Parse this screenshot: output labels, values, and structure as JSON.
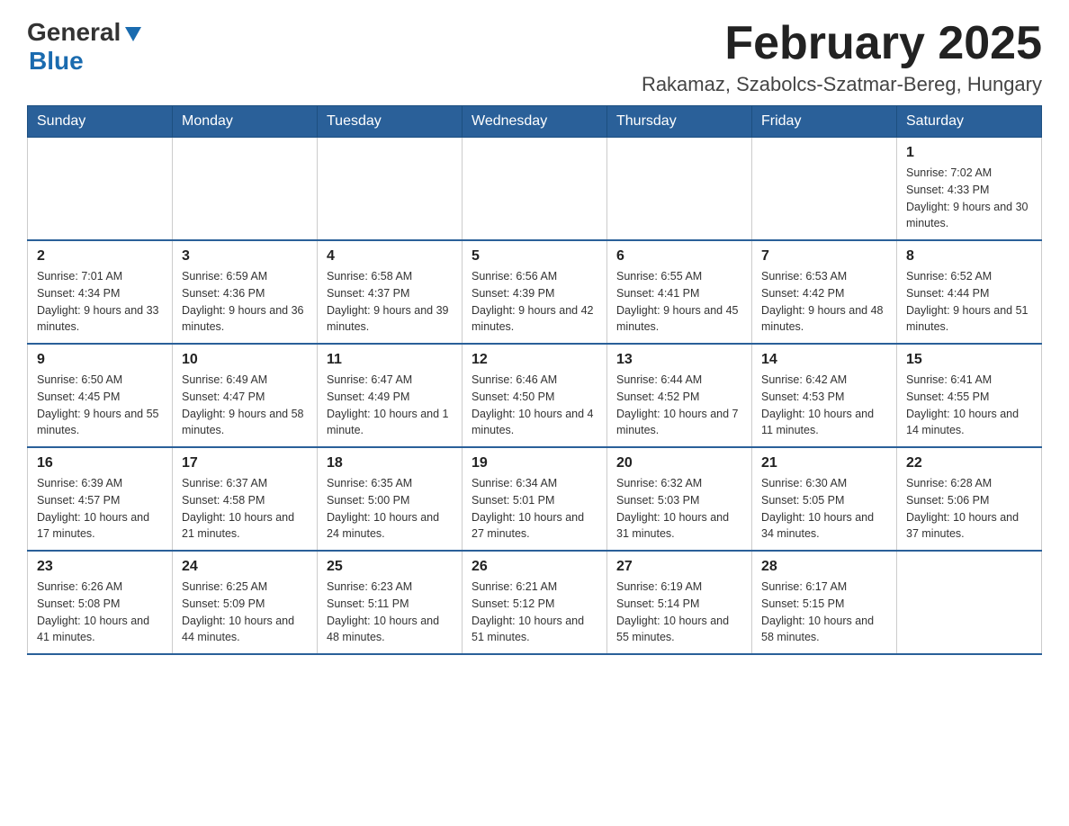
{
  "header": {
    "logo_general": "General",
    "logo_blue": "Blue",
    "title": "February 2025",
    "subtitle": "Rakamaz, Szabolcs-Szatmar-Bereg, Hungary"
  },
  "weekdays": [
    "Sunday",
    "Monday",
    "Tuesday",
    "Wednesday",
    "Thursday",
    "Friday",
    "Saturday"
  ],
  "weeks": [
    [
      {
        "day": "",
        "info": ""
      },
      {
        "day": "",
        "info": ""
      },
      {
        "day": "",
        "info": ""
      },
      {
        "day": "",
        "info": ""
      },
      {
        "day": "",
        "info": ""
      },
      {
        "day": "",
        "info": ""
      },
      {
        "day": "1",
        "info": "Sunrise: 7:02 AM\nSunset: 4:33 PM\nDaylight: 9 hours and 30 minutes."
      }
    ],
    [
      {
        "day": "2",
        "info": "Sunrise: 7:01 AM\nSunset: 4:34 PM\nDaylight: 9 hours and 33 minutes."
      },
      {
        "day": "3",
        "info": "Sunrise: 6:59 AM\nSunset: 4:36 PM\nDaylight: 9 hours and 36 minutes."
      },
      {
        "day": "4",
        "info": "Sunrise: 6:58 AM\nSunset: 4:37 PM\nDaylight: 9 hours and 39 minutes."
      },
      {
        "day": "5",
        "info": "Sunrise: 6:56 AM\nSunset: 4:39 PM\nDaylight: 9 hours and 42 minutes."
      },
      {
        "day": "6",
        "info": "Sunrise: 6:55 AM\nSunset: 4:41 PM\nDaylight: 9 hours and 45 minutes."
      },
      {
        "day": "7",
        "info": "Sunrise: 6:53 AM\nSunset: 4:42 PM\nDaylight: 9 hours and 48 minutes."
      },
      {
        "day": "8",
        "info": "Sunrise: 6:52 AM\nSunset: 4:44 PM\nDaylight: 9 hours and 51 minutes."
      }
    ],
    [
      {
        "day": "9",
        "info": "Sunrise: 6:50 AM\nSunset: 4:45 PM\nDaylight: 9 hours and 55 minutes."
      },
      {
        "day": "10",
        "info": "Sunrise: 6:49 AM\nSunset: 4:47 PM\nDaylight: 9 hours and 58 minutes."
      },
      {
        "day": "11",
        "info": "Sunrise: 6:47 AM\nSunset: 4:49 PM\nDaylight: 10 hours and 1 minute."
      },
      {
        "day": "12",
        "info": "Sunrise: 6:46 AM\nSunset: 4:50 PM\nDaylight: 10 hours and 4 minutes."
      },
      {
        "day": "13",
        "info": "Sunrise: 6:44 AM\nSunset: 4:52 PM\nDaylight: 10 hours and 7 minutes."
      },
      {
        "day": "14",
        "info": "Sunrise: 6:42 AM\nSunset: 4:53 PM\nDaylight: 10 hours and 11 minutes."
      },
      {
        "day": "15",
        "info": "Sunrise: 6:41 AM\nSunset: 4:55 PM\nDaylight: 10 hours and 14 minutes."
      }
    ],
    [
      {
        "day": "16",
        "info": "Sunrise: 6:39 AM\nSunset: 4:57 PM\nDaylight: 10 hours and 17 minutes."
      },
      {
        "day": "17",
        "info": "Sunrise: 6:37 AM\nSunset: 4:58 PM\nDaylight: 10 hours and 21 minutes."
      },
      {
        "day": "18",
        "info": "Sunrise: 6:35 AM\nSunset: 5:00 PM\nDaylight: 10 hours and 24 minutes."
      },
      {
        "day": "19",
        "info": "Sunrise: 6:34 AM\nSunset: 5:01 PM\nDaylight: 10 hours and 27 minutes."
      },
      {
        "day": "20",
        "info": "Sunrise: 6:32 AM\nSunset: 5:03 PM\nDaylight: 10 hours and 31 minutes."
      },
      {
        "day": "21",
        "info": "Sunrise: 6:30 AM\nSunset: 5:05 PM\nDaylight: 10 hours and 34 minutes."
      },
      {
        "day": "22",
        "info": "Sunrise: 6:28 AM\nSunset: 5:06 PM\nDaylight: 10 hours and 37 minutes."
      }
    ],
    [
      {
        "day": "23",
        "info": "Sunrise: 6:26 AM\nSunset: 5:08 PM\nDaylight: 10 hours and 41 minutes."
      },
      {
        "day": "24",
        "info": "Sunrise: 6:25 AM\nSunset: 5:09 PM\nDaylight: 10 hours and 44 minutes."
      },
      {
        "day": "25",
        "info": "Sunrise: 6:23 AM\nSunset: 5:11 PM\nDaylight: 10 hours and 48 minutes."
      },
      {
        "day": "26",
        "info": "Sunrise: 6:21 AM\nSunset: 5:12 PM\nDaylight: 10 hours and 51 minutes."
      },
      {
        "day": "27",
        "info": "Sunrise: 6:19 AM\nSunset: 5:14 PM\nDaylight: 10 hours and 55 minutes."
      },
      {
        "day": "28",
        "info": "Sunrise: 6:17 AM\nSunset: 5:15 PM\nDaylight: 10 hours and 58 minutes."
      },
      {
        "day": "",
        "info": ""
      }
    ]
  ]
}
